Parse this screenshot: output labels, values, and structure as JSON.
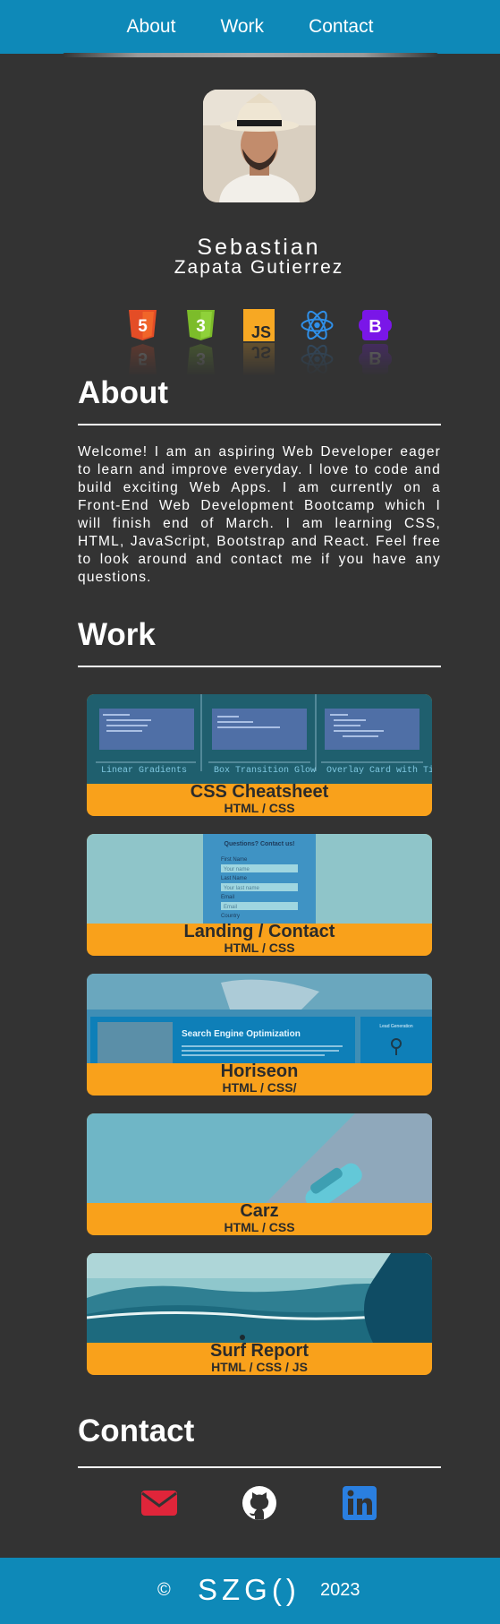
{
  "nav": {
    "items": [
      {
        "label": "About"
      },
      {
        "label": "Work"
      },
      {
        "label": "Contact"
      }
    ]
  },
  "profile": {
    "first_name": "Sebastian",
    "last_name": "Zapata Gutierrez",
    "tech_icons": [
      "html5-icon",
      "css3-icon",
      "javascript-icon",
      "react-icon",
      "bootstrap-icon"
    ]
  },
  "about": {
    "title": "About",
    "text": "Welcome! I am an aspiring Web Developer eager to learn and improve everyday. I love to code and build exciting Web Apps. I am currently on a Front-End Web Development Bootcamp which I will finish end of March. I am learning CSS, HTML, JavaScript, Bootstrap and React. Feel free to look around and contact me if you have any questions."
  },
  "work": {
    "title": "Work",
    "projects": [
      {
        "title": "CSS Cheatsheet",
        "tech": "HTML / CSS"
      },
      {
        "title": "Landing / Contact",
        "tech": "HTML / CSS"
      },
      {
        "title": "Horiseon",
        "tech": "HTML / CSS/"
      },
      {
        "title": "Carz",
        "tech": "HTML / CSS"
      },
      {
        "title": "Surf Report",
        "tech": "HTML / CSS / JS"
      }
    ],
    "shots": {
      "cheatsheet": {
        "labels": [
          "Linear Gradients",
          "Box Transition Glow",
          "Overlay Card with Title"
        ]
      },
      "landing": {
        "heading": "Questions? Contact us!",
        "fields": [
          "First Name",
          "Your name",
          "Last Name",
          "Your last name",
          "Email",
          "Email",
          "Country"
        ]
      },
      "horiseon": {
        "heading": "Search Engine Optimization",
        "side": "Lead Generation"
      }
    }
  },
  "contact": {
    "title": "Contact",
    "icons": [
      "email-icon",
      "github-icon",
      "linkedin-icon"
    ]
  },
  "footer": {
    "copyright": "©",
    "brand": "SZG()",
    "year": "2023"
  },
  "colors": {
    "header": "#0e89b8",
    "background": "#333333",
    "card_accent": "#f9a11b",
    "html5": "#e44d26",
    "css3": "#7cbc2a",
    "javascript": "#f7a823",
    "react": "#2f8fe8",
    "bootstrap": "#7a16e8",
    "email": "#e0253a",
    "linkedin": "#2a7fe0"
  }
}
